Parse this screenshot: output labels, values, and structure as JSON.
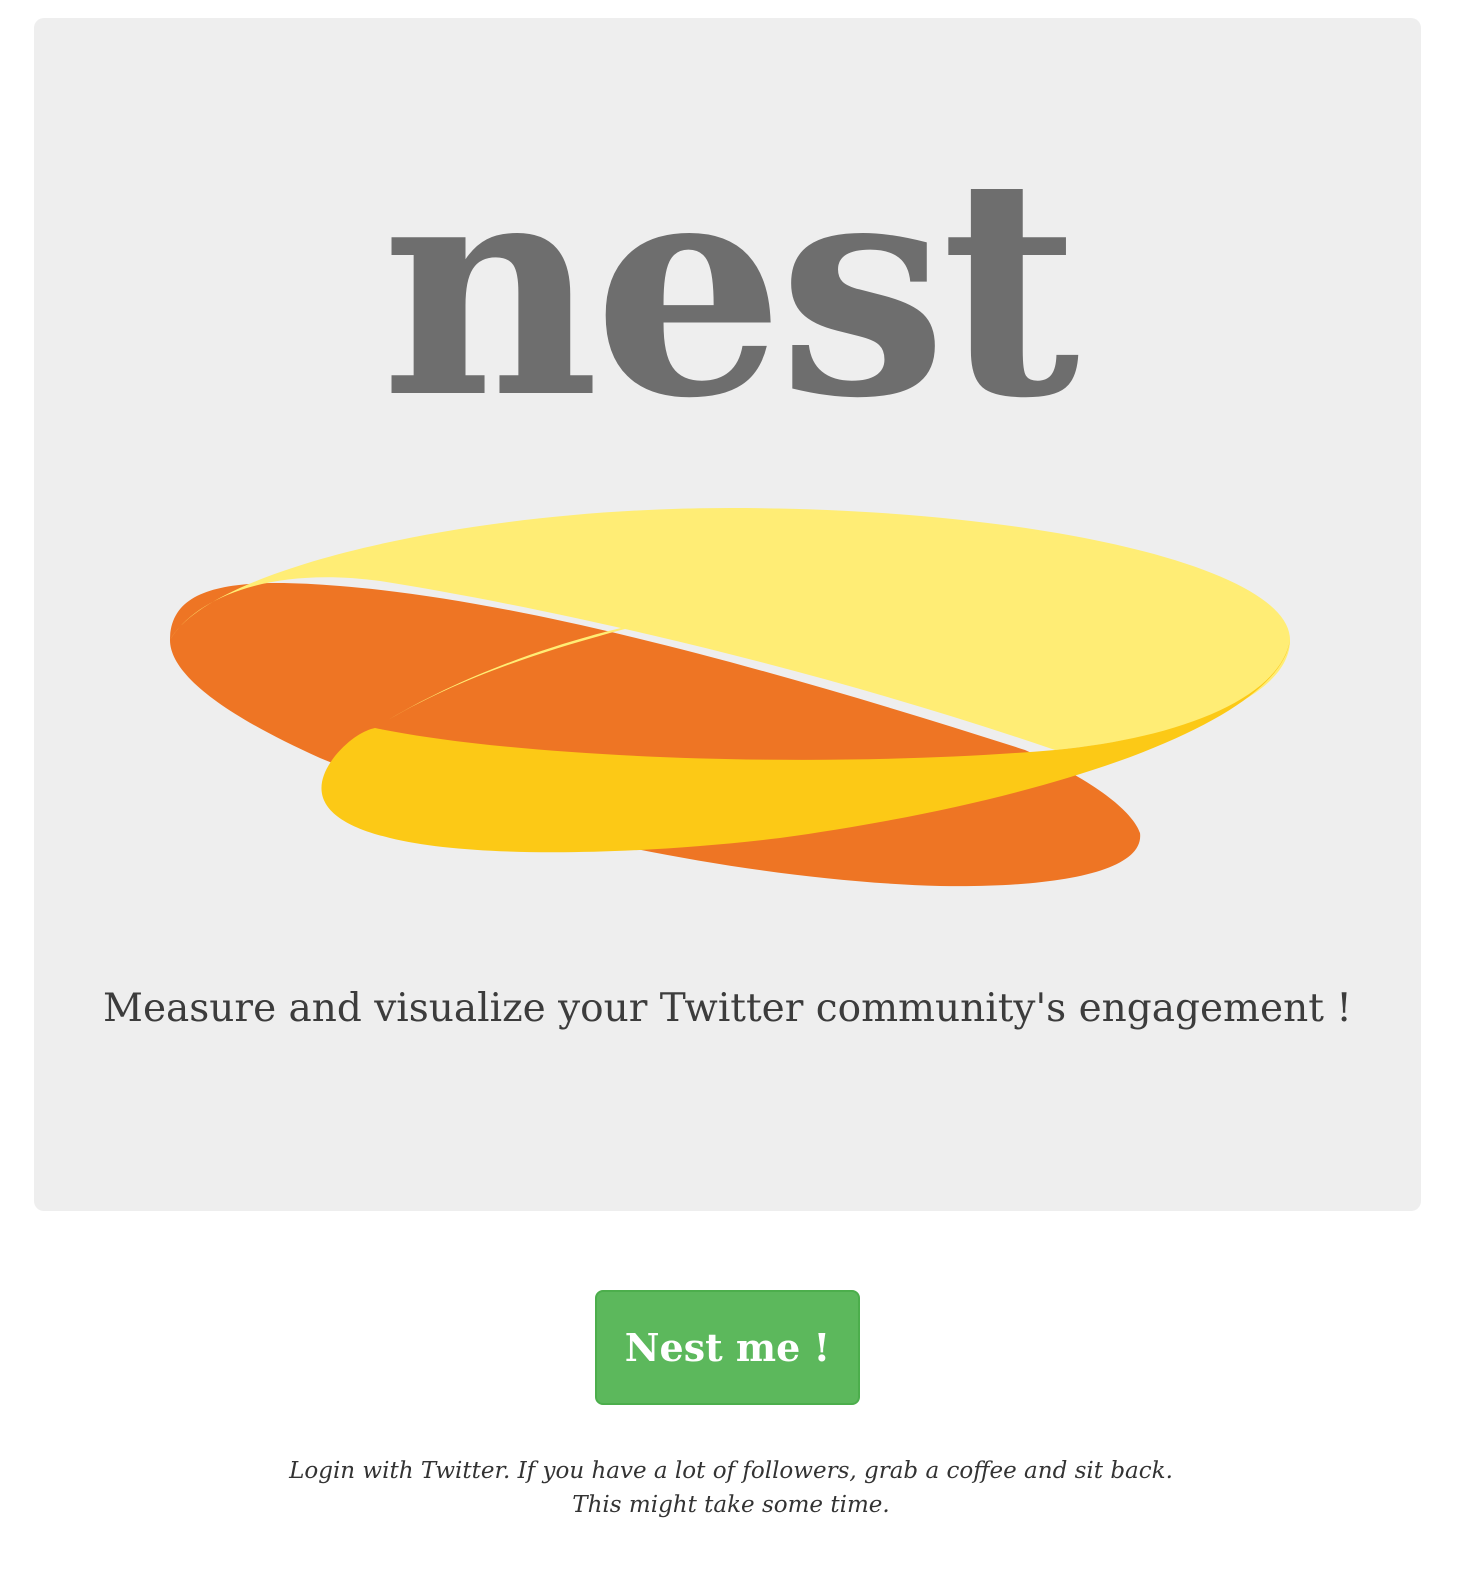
{
  "hero": {
    "title": "nest",
    "tagline": "Measure and visualize your Twitter community's engagement !"
  },
  "logo": {
    "icon": "nest-rings-logo",
    "colors": {
      "orange": "#ee7524",
      "light_yellow": "#ffed75",
      "dark_yellow": "#fcc916"
    }
  },
  "cta": {
    "label": "Nest me !",
    "color": "#5cb85c"
  },
  "note": {
    "line1": "Login with Twitter. If you have a lot of followers, grab a coffee and sit back.",
    "line2": "This might take some time."
  }
}
